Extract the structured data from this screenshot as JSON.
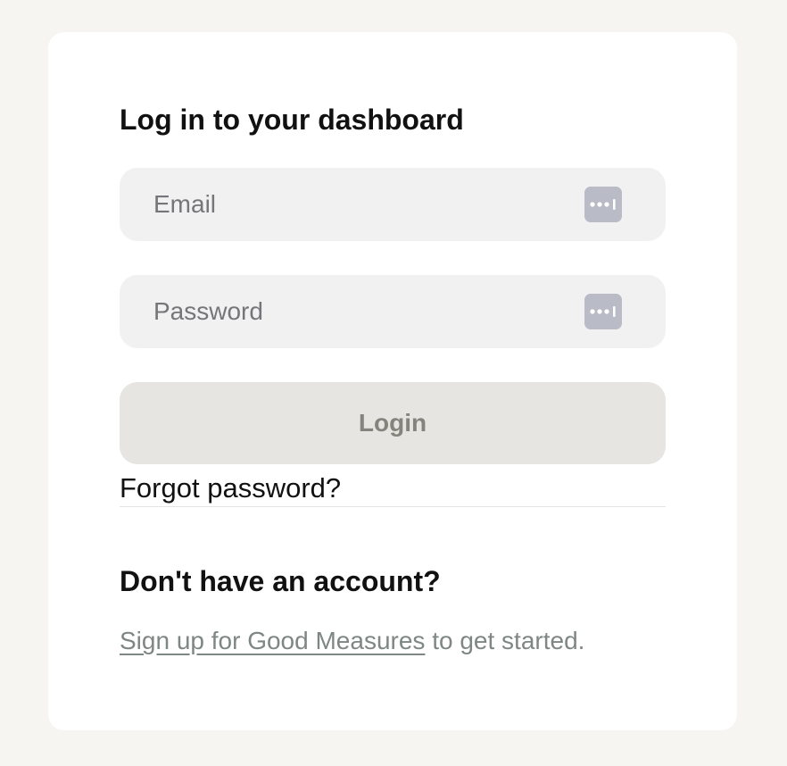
{
  "login": {
    "title": "Log in to your dashboard",
    "email_placeholder": "Email",
    "password_placeholder": "Password",
    "submit_label": "Login",
    "forgot_label": "Forgot password?"
  },
  "signup": {
    "heading": "Don't have an account?",
    "link_text": "Sign up for Good Measures",
    "trailing_text": " to get started."
  },
  "icons": {
    "field_icon": "password-manager-icon"
  },
  "colors": {
    "page_background": "#f6f5f1",
    "card_background": "#ffffff",
    "field_background": "#f1f1f1",
    "button_background": "#e6e5e1",
    "button_text": "#84837c",
    "link_text": "#7e8784",
    "icon_badge": "#b9bbc6"
  }
}
